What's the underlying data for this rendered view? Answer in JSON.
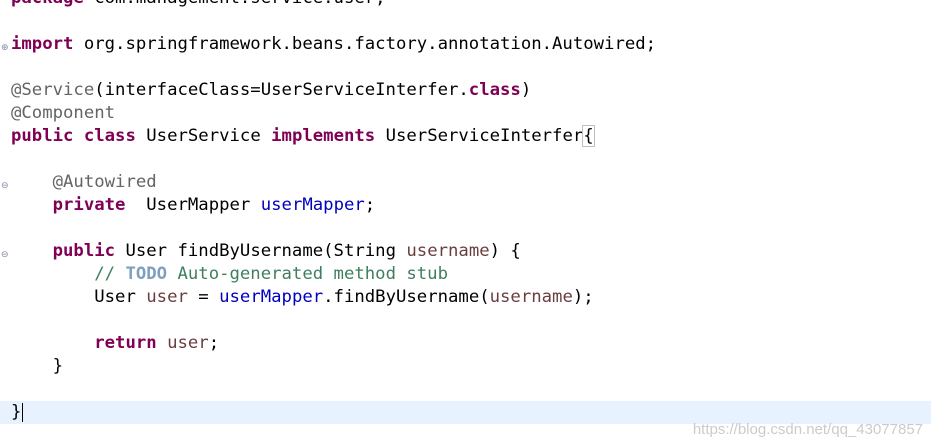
{
  "editor": {
    "lines": {
      "l1": {
        "kw": "package",
        "rest": " com.management.service.user;"
      },
      "l3": {
        "kw": "import",
        "rest": " org.springframework.beans.factory.annotation.Autowired;"
      },
      "l5": {
        "ann": "@Service",
        "a": "(interfaceClass=UserServiceInterfer.",
        "kw": "class",
        "b": ")"
      },
      "l6": {
        "ann": "@Component"
      },
      "l7": {
        "kw1": "public",
        "kw2": "class",
        "a": " UserService ",
        "kw3": "implements",
        "b": " UserServiceInterfer",
        "brace": "{"
      },
      "l9": {
        "indent": "    ",
        "ann": "@Autowired"
      },
      "l10": {
        "indent": "    ",
        "kw": "private",
        "a": "  UserMapper ",
        "field": "userMapper",
        "b": ";"
      },
      "l12": {
        "indent": "    ",
        "kw": "public",
        "a": " User findByUsername(String ",
        "param": "username",
        "b": ") {"
      },
      "l13": {
        "indent": "        ",
        "c1": "// ",
        "todo": "TODO",
        "c2": " Auto-generated method stub"
      },
      "l14": {
        "indent": "        ",
        "a": "User ",
        "param1": "user",
        "b": " = ",
        "field": "userMapper",
        "c": ".findByUsername(",
        "param2": "username",
        "d": ");"
      },
      "l16": {
        "indent": "        ",
        "kw": "return",
        "a": " ",
        "param": "user",
        "b": ";"
      },
      "l17": {
        "indent": "    ",
        "a": "}"
      },
      "l19": {
        "a": "}"
      }
    }
  },
  "watermark": "https://blog.csdn.net/qq_43077857"
}
